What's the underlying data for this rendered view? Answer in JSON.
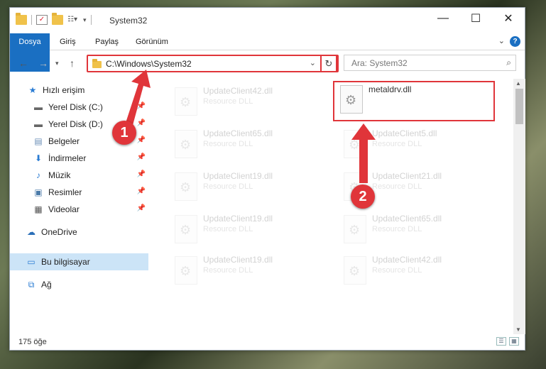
{
  "window": {
    "title": "System32",
    "controls": {
      "minimize": "—",
      "maximize": "☐",
      "close": "✕"
    }
  },
  "ribbon": {
    "tabs": [
      "Dosya",
      "Giriş",
      "Paylaş",
      "Görünüm"
    ],
    "help": "?"
  },
  "address": {
    "path": "C:\\Windows\\System32"
  },
  "search": {
    "placeholder": "Ara: System32"
  },
  "sidebar": {
    "items": [
      {
        "label": "Hızlı erişim",
        "icon": "star-icon"
      },
      {
        "label": "Yerel Disk (C:)",
        "icon": "drive-icon"
      },
      {
        "label": "Yerel Disk (D:)",
        "icon": "drive-icon"
      },
      {
        "label": "Belgeler",
        "icon": "documents-icon"
      },
      {
        "label": "İndirmeler",
        "icon": "downloads-icon"
      },
      {
        "label": "Müzik",
        "icon": "music-icon"
      },
      {
        "label": "Resimler",
        "icon": "pictures-icon"
      },
      {
        "label": "Videolar",
        "icon": "videos-icon"
      },
      {
        "label": "OneDrive",
        "icon": "cloud-icon"
      },
      {
        "label": "Bu bilgisayar",
        "icon": "computer-icon"
      },
      {
        "label": "Ağ",
        "icon": "network-icon"
      }
    ]
  },
  "files": [
    {
      "name": "UpdateClient42.dll",
      "type": "Resource DLL"
    },
    {
      "name": "metaldrv.dll",
      "type": ""
    },
    {
      "name": "UpdateClient65.dll",
      "type": "Resource DLL"
    },
    {
      "name": "UpdateClient5.dll",
      "type": "Resource DLL"
    },
    {
      "name": "UpdateClient19.dll",
      "type": "Resource DLL"
    },
    {
      "name": "UpdateClient21.dll",
      "type": "Resource DLL"
    },
    {
      "name": "UpdateClient19.dll",
      "type": "Resource DLL"
    },
    {
      "name": "UpdateClient65.dll",
      "type": "Resource DLL"
    },
    {
      "name": "UpdateClient19.dll",
      "type": "Resource DLL"
    },
    {
      "name": "UpdateClient42.dll",
      "type": "Resource DLL"
    }
  ],
  "status": {
    "count": "175 öğe"
  },
  "annotations": {
    "marker1": "1",
    "marker2": "2",
    "color": "#e0353a"
  }
}
